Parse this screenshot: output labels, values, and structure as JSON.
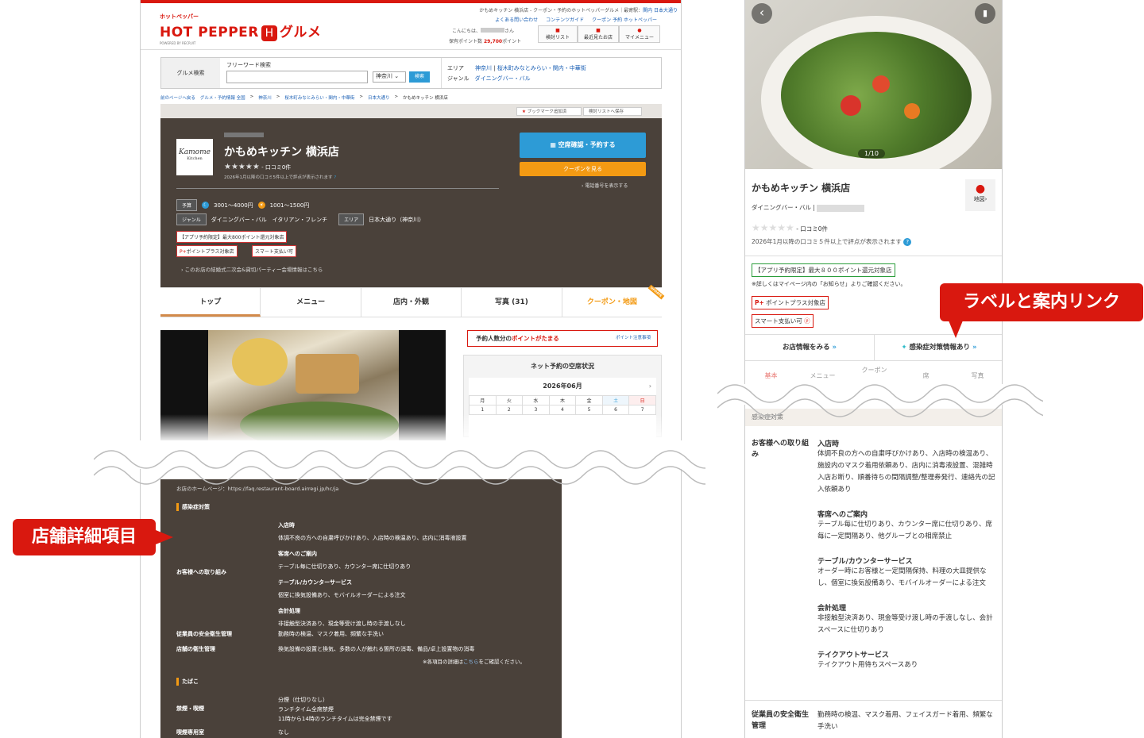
{
  "desktop": {
    "logo_small": "ホットペッパー",
    "logo": "HOT PEPPER",
    "logo_mark": "H",
    "logo_gourmet": "グルメ",
    "logo_powered": "POWERED BY RECRUIT",
    "header_crumb": "かもめキッチン 横浜店 - クーポン・予約のホットペッパーグルメ｜最寄駅：",
    "header_crumb_link": "関内 日本大通り",
    "links": [
      "よくある問い合わせ",
      "コンテンツガイド",
      "クーポン 予約 ホットペッパー"
    ],
    "greeting": "こんにちは、",
    "greeting_suffix": "さん",
    "points_label": "保有ポイント数",
    "points_value": "29,700",
    "points_unit": "ポイント",
    "header_btns": [
      "検討リスト",
      "最近見たお店",
      "マイメニュー"
    ],
    "search_title": "グルメ検索",
    "freeword_label": "フリーワード検索",
    "pref": "神奈川",
    "search_btn": "検索",
    "area_label": "エリア",
    "area_links": [
      "神奈川",
      "桜木町みなとみらい・関内・中華街"
    ],
    "genre_label": "ジャンル",
    "genre_link": "ダイニングバー・バル",
    "breadcrumb": [
      "前のページへ戻る",
      "グルメ・予約情報 全国",
      "神奈川",
      "桜木町みなとみらい・関内・中華街",
      "日本大通り",
      "かもめキッチン 横浜店"
    ],
    "bookmark": "ブックマーク追加済",
    "saved": "検討リストへ保存",
    "logo_text": "Kamome",
    "logo_sub": "Kitchen",
    "shop_name": "かもめキッチン 横浜店",
    "review": "- 口コミ0件",
    "review_note": "2026年1月以降の口コミ5件以上で評点が表示されます",
    "btn_reserve": "空席確認・予約する",
    "btn_coupon": "クーポンを見る",
    "tel": "電話番号を表示する",
    "budget_label": "予算",
    "budget_dinner": "3001～4000円",
    "budget_lunch": "1001～1500円",
    "genre_row_label": "ジャンル",
    "genre_row": "ダイニングバー・バル　イタリアン・フレンチ",
    "area_row_label": "エリア",
    "area_row": "日本大通り（神奈川）",
    "tag1": "【アプリ予約限定】最大800ポイント還元対象店",
    "tag2": "ポイントプラス対象店",
    "tag3": "スマート支払い可",
    "party_link": "このお店の結婚式二次会&貸切パーティー会場情報はこちら",
    "tabs": [
      "トップ",
      "メニュー",
      "店内・外観",
      "写真 (31)",
      "クーポン・地図"
    ],
    "tab_badge": "UPDATE",
    "points_banner_pre": "予約人数分の",
    "points_banner_hl": "ポイントがたまる",
    "points_banner_note": "ポイント注意事項",
    "vacancy_title": "ネット予約の空席状況",
    "month": "2026年06月",
    "weekdays": [
      "月",
      "火",
      "水",
      "木",
      "金",
      "土",
      "日"
    ],
    "days": [
      "1",
      "2",
      "3",
      "4",
      "5",
      "6",
      "7"
    ],
    "homepage": "お店のホームページ：https://faq.restaurant-board.airregi.jp/hc/ja",
    "sec1": "感染症対策",
    "row1_label": "お客様への取り組み",
    "items": [
      {
        "h": "入店時",
        "t": "体調不良の方への自粛呼びかけあり、入店時の検温あり、店内に消毒液設置"
      },
      {
        "h": "客席へのご案内",
        "t": "テーブル毎に仕切りあり、カウンター席に仕切りあり"
      },
      {
        "h": "テーブル/カウンターサービス",
        "t": "個室に換気設備あり、モバイルオーダーによる注文"
      },
      {
        "h": "会計処理",
        "t": "非接触型決済あり、現金等受け渡し時の手渡しなし"
      }
    ],
    "row2_label": "従業員の安全衛生管理",
    "row2_text": "勤務時の検温、マスク着用、頻繁な手洗い",
    "row3_label": "店舗の衛生管理",
    "row3_text": "換気設備の設置と換気、多数の人が触れる箇所の消毒、備品/卓上設置物の消毒",
    "note_pre": "※各項目の詳細は",
    "note_link": "こちら",
    "note_post": "をご確認ください。",
    "sec2": "たばこ",
    "smoke_label": "禁煙・喫煙",
    "smoke_text": [
      "分煙（仕切りなし）",
      "ランチタイム全席禁煙",
      "11時から14時のランチタイムは完全禁煙です"
    ],
    "smoke_room_label": "喫煙専用室",
    "smoke_room_text": "なし"
  },
  "mobile": {
    "photo_counter": "1/10",
    "shop_name": "かもめキッチン 横浜店",
    "map_label": "地図",
    "genre": "ダイニングバー・バル",
    "review": "- 口コミ0件",
    "review_note": "2026年1月以降の口コミ５件以上で評点が表示されます",
    "tag1": "【アプリ予約限定】最大８００ポイント還元対象店",
    "tag1_note": "※詳しくはマイページ内の「お知らせ」よりご確認ください。",
    "tag2": "ポイントプラス対象店",
    "tag3": "スマート支払い可",
    "btn_info": "お店情報をみる",
    "btn_infection": "感染症対策情報あり",
    "tabs": [
      "基本",
      "メニュー",
      "クーポン",
      "席",
      "写真"
    ],
    "sec": "感染症対策",
    "row1_label": "お客様への取り組み",
    "items": [
      {
        "h": "入店時",
        "t": "体調不良の方への自粛呼びかけあり、入店時の検温あり、施設内のマスク着用依頼あり、店内に消毒液設置、混雑時入店お断り、順番待ちの間隔調整/整理券発行、連絡先の記入依頼あり"
      },
      {
        "h": "客席へのご案内",
        "t": "テーブル毎に仕切りあり、カウンター席に仕切りあり、席毎に一定間隔あり、他グループとの相席禁止"
      },
      {
        "h": "テーブル/カウンターサービス",
        "t": "オーダー時にお客様と一定間隔保持、料理の大皿提供なし、個室に換気設備あり、モバイルオーダーによる注文"
      },
      {
        "h": "会計処理",
        "t": "非接触型決済あり、現金等受け渡し時の手渡しなし、会計スペースに仕切りあり"
      },
      {
        "h": "テイクアウトサービス",
        "t": "テイクアウト用待ちスペースあり"
      }
    ],
    "row2_label": "従業員の安全衛生管理",
    "row2_text": "勤務時の検温、マスク着用、フェイスガード着用、頻繁な手洗い"
  },
  "callouts": {
    "left": "店舗詳細項目",
    "right": "ラベルと案内リンク"
  },
  "colors": {
    "brand": "#d9180f",
    "accent": "#f39a13",
    "shop_bg": "#4a413a",
    "blue": "#2d9bd6"
  }
}
